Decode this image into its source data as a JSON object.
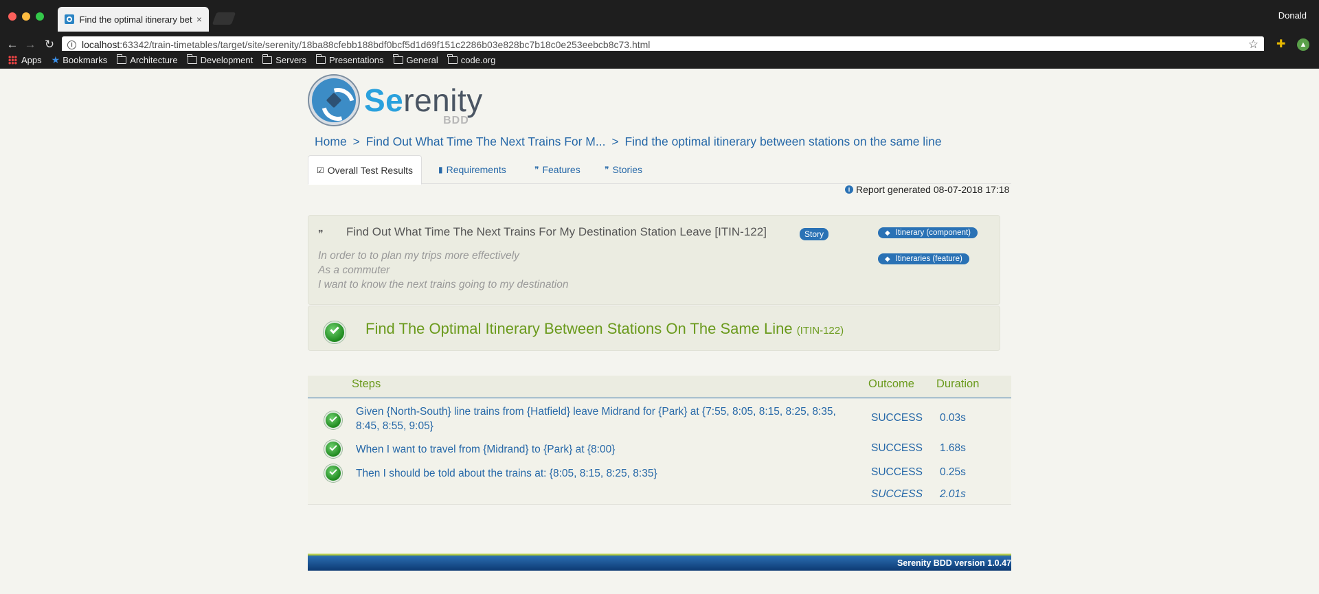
{
  "browser": {
    "tab_title": "Find the optimal itinerary betw",
    "tab_close": "×",
    "user": "Donald",
    "url_host": "localhost",
    "url_rest": ":63342/train-timetables/target/site/serenity/18ba88cfebb188bdf0bcf5d1d69f151c2286b03e828bc7b18c0e253eebcb8c73.html",
    "bookmarks": [
      "Apps",
      "Bookmarks",
      "Architecture",
      "Development",
      "Servers",
      "Presentations",
      "General",
      "code.org"
    ]
  },
  "logo": {
    "prefix": "Se",
    "rest": "renity",
    "sub": "BDD"
  },
  "breadcrumb": {
    "home": "Home",
    "sep": ">",
    "story": "Find Out What Time The Next Trains For M...",
    "current": "Find the optimal itinerary between stations on the same line"
  },
  "tabs": {
    "overall": "Overall Test Results",
    "requirements": "Requirements",
    "features": "Features",
    "stories": "Stories"
  },
  "report": {
    "generated": "Report generated 08-07-2018 17:18"
  },
  "story": {
    "title": "Find Out What Time The Next Trains For My Destination Station Leave [ITIN-122]",
    "badge": "Story",
    "tags": [
      "Itinerary (component)",
      "Itineraries (feature)"
    ],
    "narrative": [
      "In order to to plan my trips more effectively",
      "As a commuter",
      "I want to know the next trains going to my destination"
    ]
  },
  "scenario": {
    "title": "Find The Optimal Itinerary Between Stations On The Same Line",
    "id": "(ITIN-122)"
  },
  "steps": {
    "headers": {
      "steps": "Steps",
      "outcome": "Outcome",
      "duration": "Duration"
    },
    "rows": [
      {
        "text": "Given {North-South} line trains from {Hatfield} leave Midrand for {Park} at {7:55, 8:05, 8:15, 8:25, 8:35, 8:45, 8:55, 9:05}",
        "outcome": "SUCCESS",
        "duration": "0.03s"
      },
      {
        "text": "When I want to travel from {Midrand} to {Park} at {8:00}",
        "outcome": "SUCCESS",
        "duration": "1.68s"
      },
      {
        "text": "Then I should be told about the trains at: {8:05, 8:15, 8:25, 8:35}",
        "outcome": "SUCCESS",
        "duration": "0.25s"
      }
    ],
    "total": {
      "outcome": "SUCCESS",
      "duration": "2.01s"
    }
  },
  "footer": {
    "version": "Serenity BDD version 1.0.47"
  },
  "colors": {
    "link": "#2668a8",
    "success_green": "#6a9a1c",
    "badge_blue": "#2a72b5",
    "page_bg": "#f4f4ef"
  }
}
